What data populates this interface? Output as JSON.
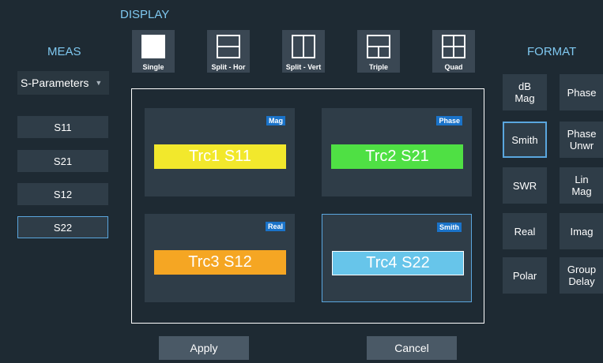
{
  "display": {
    "title": "DISPLAY",
    "layouts": [
      {
        "label": "Single",
        "icon": "single-layout-icon"
      },
      {
        "label": "Split - Hor",
        "icon": "split-horizontal-layout-icon"
      },
      {
        "label": "Split - Vert",
        "icon": "split-vertical-layout-icon"
      },
      {
        "label": "Triple",
        "icon": "triple-layout-icon"
      },
      {
        "label": "Quad",
        "icon": "quad-layout-icon"
      }
    ],
    "selected_layout": "Quad",
    "traces": [
      {
        "label": "Trc1 S11",
        "format": "Mag",
        "color": "#f2e82c"
      },
      {
        "label": "Trc2 S21",
        "format": "Phase",
        "color": "#4fe044"
      },
      {
        "label": "Trc3 S12",
        "format": "Real",
        "color": "#f5a623"
      },
      {
        "label": "Trc4 S22",
        "format": "Smith",
        "color": "#67c5ea"
      }
    ],
    "selected_trace": "Trc4 S22"
  },
  "meas": {
    "title": "MEAS",
    "dropdown_value": "S-Parameters",
    "items": [
      "S11",
      "S21",
      "S12",
      "S22"
    ],
    "selected": "S22"
  },
  "format": {
    "title": "FORMAT",
    "items": [
      "dB\nMag",
      "Phase",
      "Smith",
      "Phase\nUnwr",
      "SWR",
      "Lin\nMag",
      "Real",
      "Imag",
      "Polar",
      "Group\nDelay"
    ],
    "selected": "Smith"
  },
  "actions": {
    "apply": "Apply",
    "cancel": "Cancel"
  },
  "colors": {
    "accent": "#5aa6de",
    "background": "#1e2a33",
    "tag": "#1a73c9"
  }
}
